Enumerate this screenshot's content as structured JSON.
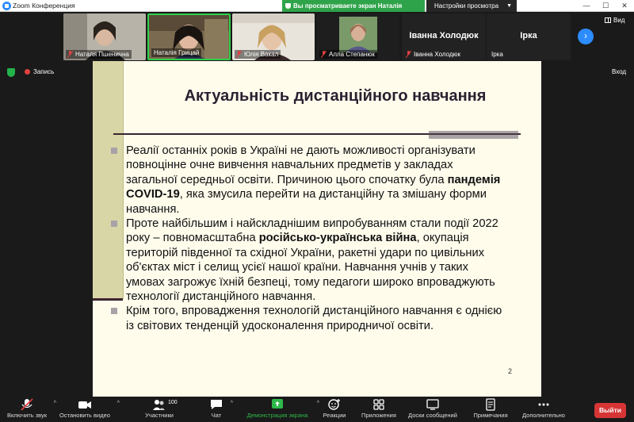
{
  "window": {
    "title": "Zoom Конференция",
    "share_banner": "Вы просматриваете экран Наталія Грицай",
    "view_options": "Настройки просмотра"
  },
  "gallery": {
    "participants": [
      {
        "name": "Наталя Пшеничнa",
        "muted": true
      },
      {
        "name": "Наталія Грицай",
        "muted": false
      },
      {
        "name": "Юлія Вакал",
        "muted": true
      },
      {
        "name": "Алла Степанюк",
        "muted": true
      },
      {
        "name": "Іванна Холодюк",
        "label": "Іванна Холодюк",
        "muted": true
      },
      {
        "name": "Ірка",
        "label": "Ірка",
        "muted": false
      }
    ],
    "view_label": "Вид"
  },
  "meeting": {
    "recording_label": "Запись",
    "enter_label": "Вход"
  },
  "slide": {
    "title": "Актуальність дистанційного навчання",
    "bullets": [
      {
        "before": "Реалії останніх років в Україні не дають можливості організувати повноцінне очне вивчення навчальних предметів у закладах загальної середньої освіти. Причиною цього спочатку була ",
        "bold": "пандемія COVID-19",
        "after": ", яка змусила перейти на дистанційну та змішану форми навчання."
      },
      {
        "before": "Проте найбільшим і найскладнішим випробуванням стали події 2022 року – повномасштабна ",
        "bold": "російсько-українська війна",
        "after": ", окупація територій південної та східної України, ракетні удари по цивільних об'єктах міст і селищ усієї нашої країни. Навчання учнів у таких умовах загрожує їхній безпеці, тому педагоги широко впроваджують технології дистанційного навчання."
      },
      {
        "before": "Крім того, впровадження технологій дистанційного навчання є однією із світових тенденцій удосконалення природничої освіти.",
        "bold": "",
        "after": ""
      }
    ],
    "page_number": "2"
  },
  "toolbar": {
    "mute": "Включить звук",
    "video": "Остановить видео",
    "participants": "Участники",
    "participants_count": "100",
    "chat": "Чат",
    "share": "Демонстрация экрана",
    "reactions": "Реакции",
    "apps": "Приложения",
    "whiteboards": "Доски сообщений",
    "notes": "Примечания",
    "more": "Дополнительно",
    "leave": "Выйти"
  },
  "colors": {
    "accent_blue": "#2d8cff",
    "share_green": "#2fa34a",
    "leave_red": "#d73535",
    "slide_bg": "#fffcec"
  }
}
